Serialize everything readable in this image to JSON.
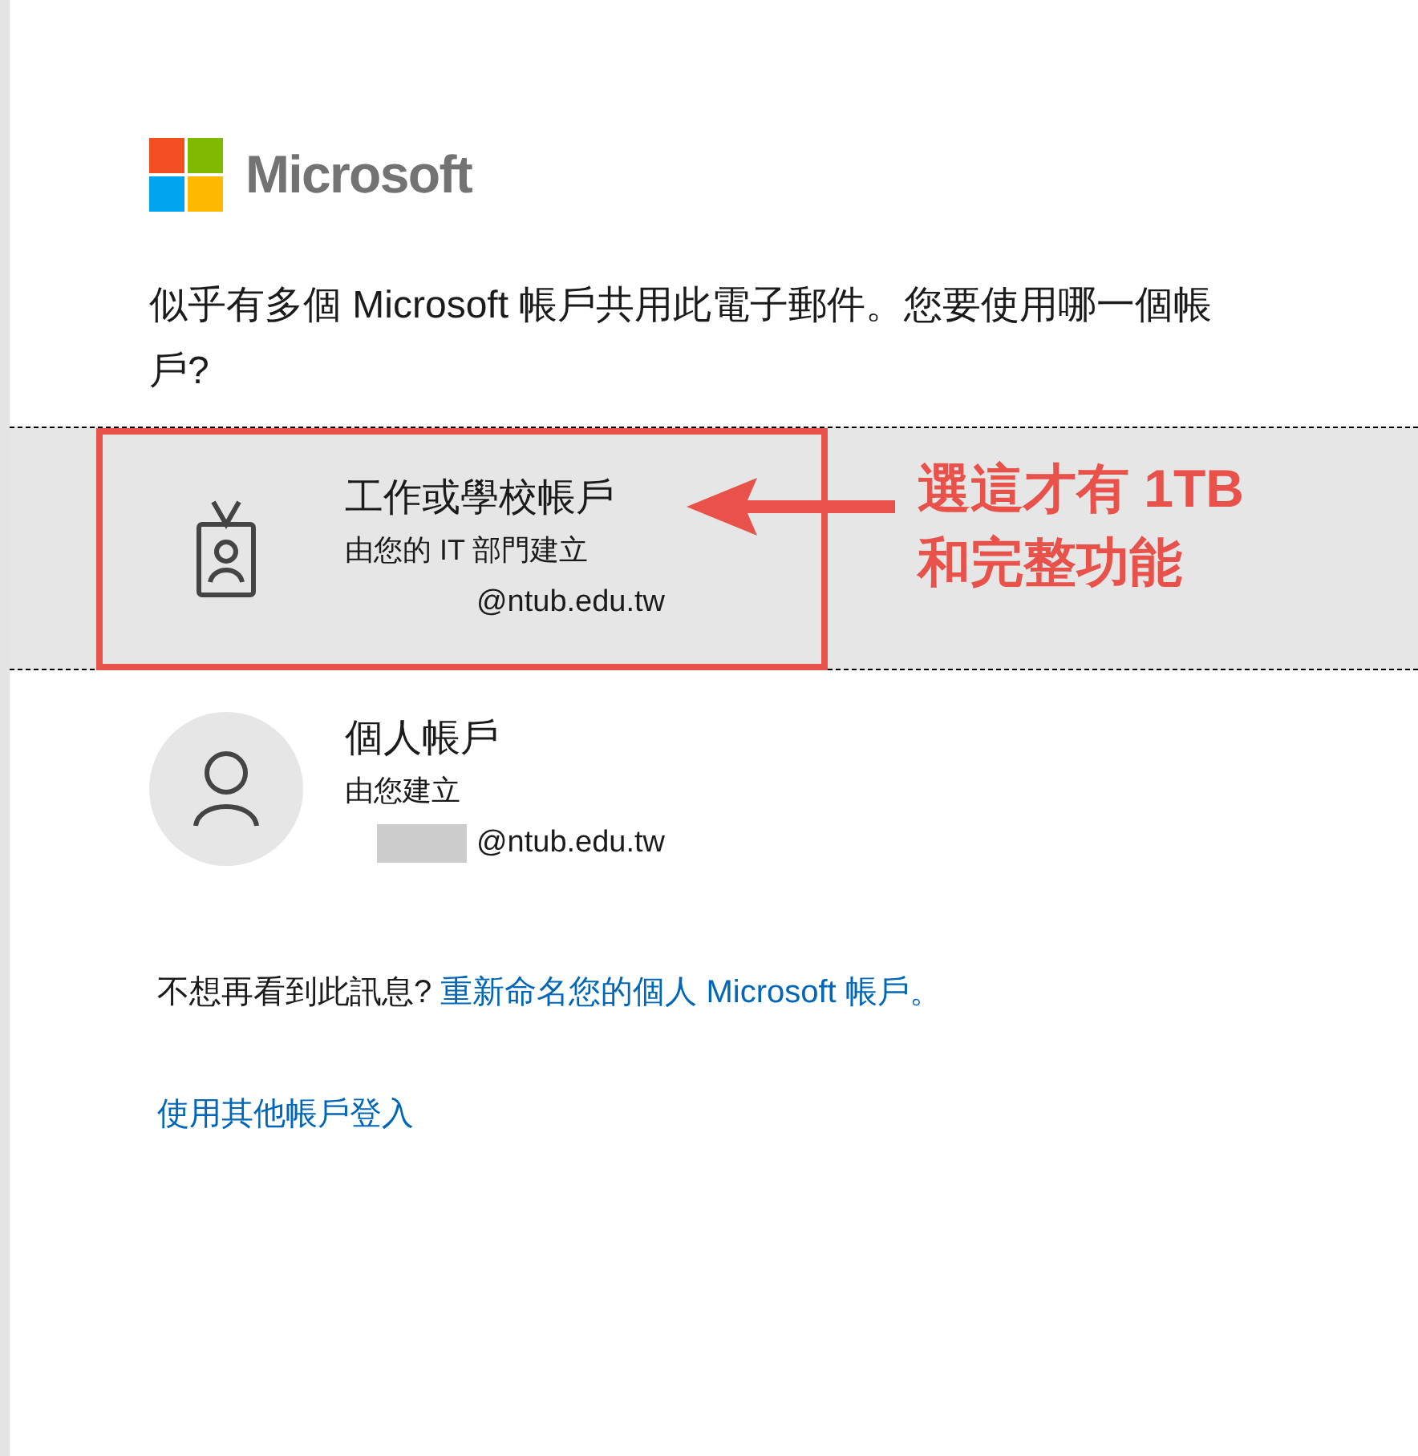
{
  "logo": {
    "text": "Microsoft"
  },
  "prompt": "似乎有多個 Microsoft 帳戶共用此電子郵件。您要使用哪一個帳戶?",
  "accounts": [
    {
      "kind": "work",
      "title": "工作或學校帳戶",
      "subtitle": "由您的 IT 部門建立",
      "email": "@ntub.edu.tw",
      "selected": true,
      "redacted": false
    },
    {
      "kind": "personal",
      "title": "個人帳戶",
      "subtitle": "由您建立",
      "email": "@ntub.edu.tw",
      "selected": false,
      "redacted": true
    }
  ],
  "message": {
    "text": "不想再看到此訊息? ",
    "link": "重新命名您的個人 Microsoft 帳戶。"
  },
  "other_signin": "使用其他帳戶登入",
  "annotation": {
    "lines": [
      "選這才有 1TB",
      "和完整功能"
    ]
  }
}
